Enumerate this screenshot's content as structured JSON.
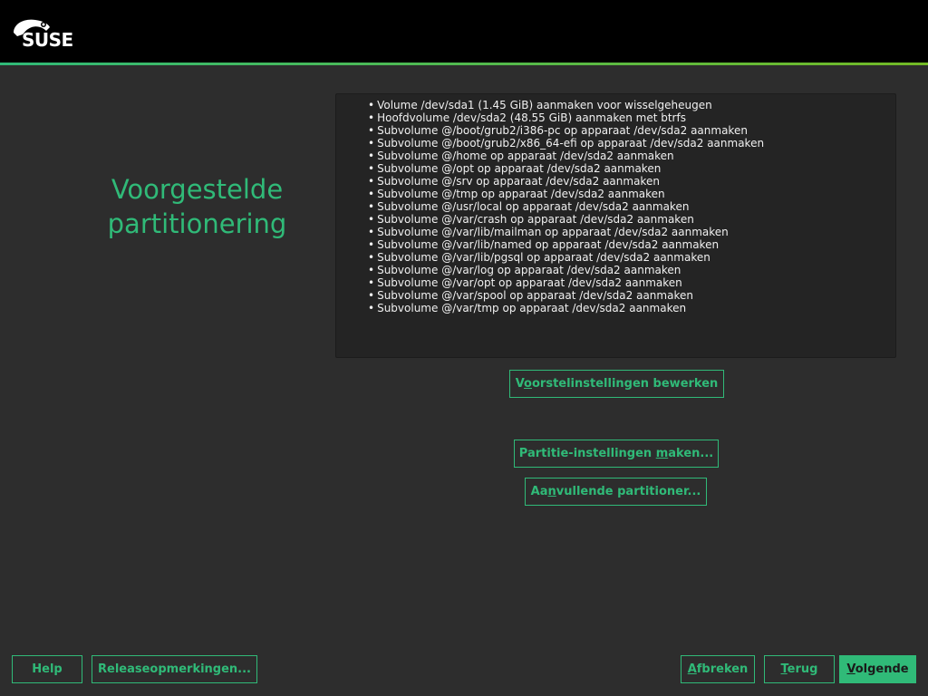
{
  "header": {
    "logo_text": "SUSE"
  },
  "page": {
    "title_line1": "Voorgestelde",
    "title_line2": "partitionering"
  },
  "summary": {
    "items": [
      "Volume /dev/sda1 (1.45 GiB) aanmaken voor wisselgeheugen",
      "Hoofdvolume /dev/sda2 (48.55 GiB) aanmaken met btrfs",
      "Subvolume @/boot/grub2/i386-pc op apparaat /dev/sda2 aanmaken",
      "Subvolume @/boot/grub2/x86_64-efi op apparaat /dev/sda2 aanmaken",
      "Subvolume @/home op apparaat /dev/sda2 aanmaken",
      "Subvolume @/opt op apparaat /dev/sda2 aanmaken",
      "Subvolume @/srv op apparaat /dev/sda2 aanmaken",
      "Subvolume @/tmp op apparaat /dev/sda2 aanmaken",
      "Subvolume @/usr/local op apparaat /dev/sda2 aanmaken",
      "Subvolume @/var/crash op apparaat /dev/sda2 aanmaken",
      "Subvolume @/var/lib/mailman op apparaat /dev/sda2 aanmaken",
      "Subvolume @/var/lib/named op apparaat /dev/sda2 aanmaken",
      "Subvolume @/var/lib/pgsql op apparaat /dev/sda2 aanmaken",
      "Subvolume @/var/log op apparaat /dev/sda2 aanmaken",
      "Subvolume @/var/opt op apparaat /dev/sda2 aanmaken",
      "Subvolume @/var/spool op apparaat /dev/sda2 aanmaken",
      "Subvolume @/var/tmp op apparaat /dev/sda2 aanmaken"
    ]
  },
  "buttons": {
    "edit_proposal": {
      "pre": "V",
      "key": "o",
      "post": "orstelinstellingen bewerken"
    },
    "create_partition": {
      "pre": "Partitie-instellingen ",
      "key": "m",
      "post": "aken..."
    },
    "expert_partitioner": {
      "pre": "Aa",
      "key": "n",
      "post": "vullende partitioner..."
    },
    "help": "Help",
    "release_notes": "Releaseopmerkingen...",
    "abort": {
      "pre": "",
      "key": "A",
      "post": "fbreken"
    },
    "back": {
      "pre": "",
      "key": "T",
      "post": "erug"
    },
    "next": {
      "pre": "",
      "key": "V",
      "post": "olgende"
    }
  },
  "colors": {
    "accent": "#30ba78",
    "background": "#2d2d2d",
    "header": "#000000"
  },
  "icons": {
    "logo": "suse-chameleon-icon"
  }
}
